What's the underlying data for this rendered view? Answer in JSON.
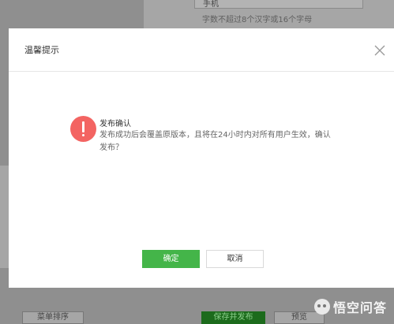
{
  "background": {
    "field_value": "手机",
    "field_hint": "字数不超过8个汉字或16个字母",
    "bottom_buttons": {
      "sort": "菜单排序",
      "save_publish": "保存并发布",
      "preview": "预览"
    }
  },
  "dialog": {
    "title": "温馨提示",
    "close_icon": "close-icon",
    "message_title": "发布确认",
    "message_body": "发布成功后会覆盖原版本，且将在24小时内对所有用户生效，确认发布？",
    "confirm_label": "确定",
    "cancel_label": "取消"
  },
  "watermark": {
    "text": "悟空问答"
  },
  "colors": {
    "confirm": "#44b549",
    "warning": "#f36462"
  }
}
